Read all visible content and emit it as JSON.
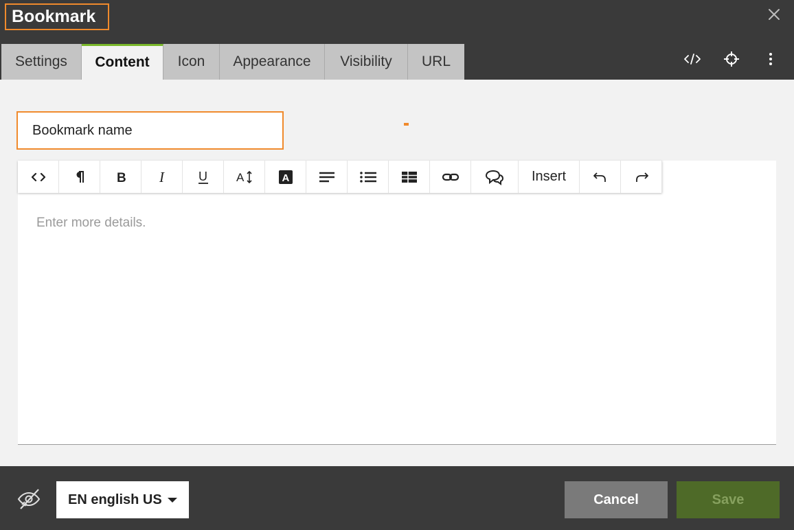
{
  "dialog": {
    "title": "Bookmark"
  },
  "tabs": [
    {
      "label": "Settings"
    },
    {
      "label": "Content"
    },
    {
      "label": "Icon"
    },
    {
      "label": "Appearance"
    },
    {
      "label": "Visibility"
    },
    {
      "label": "URL"
    }
  ],
  "active_tab": "Content",
  "header_icons": [
    "code-view-icon",
    "crosshair-icon",
    "more-vertical-icon",
    "close-icon"
  ],
  "content": {
    "name_value": "Bookmark name",
    "details_placeholder": "Enter more details."
  },
  "toolbar": {
    "buttons": [
      "source-code-icon",
      "paragraph-icon",
      "bold-icon",
      "italic-icon",
      "underline-icon",
      "font-size-icon",
      "text-color-icon",
      "align-icon",
      "bullet-list-icon",
      "table-icon",
      "link-icon",
      "comments-icon",
      "insert-menu",
      "undo-icon",
      "redo-icon"
    ],
    "insert_label": "Insert"
  },
  "footer": {
    "visibility_icon": "eye-off-icon",
    "language": "EN english US",
    "cancel_label": "Cancel",
    "save_label": "Save"
  },
  "colors": {
    "header_bg": "#3a3a3a",
    "highlight": "#f08a2c",
    "active_tab_accent": "#7ab82a",
    "save_bg": "#4e6a28",
    "cancel_bg": "#7a7a7a"
  }
}
